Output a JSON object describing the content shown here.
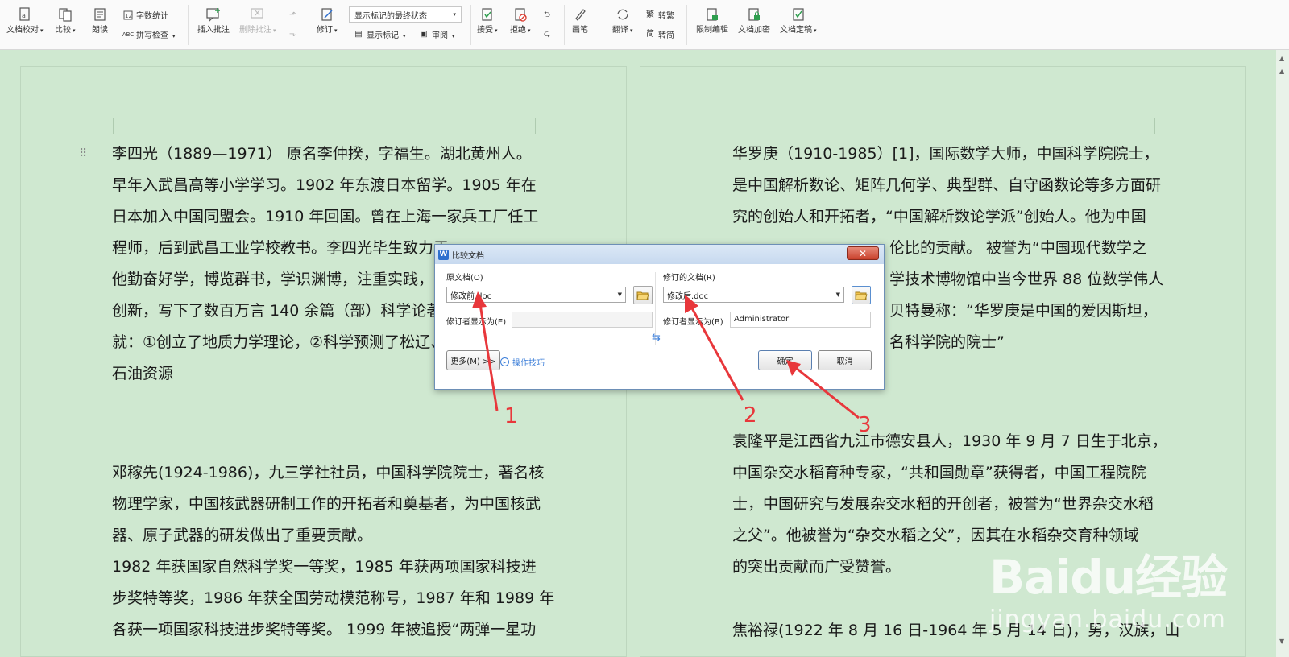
{
  "toolbar": {
    "doc_check": "文档校对",
    "compare": "比较",
    "read_aloud": "朗读",
    "word_count": "字数统计",
    "spell_check": "拼写检查",
    "insert_comment": "插入批注",
    "delete_comment": "删除批注",
    "revise": "修订",
    "markup_state": "显示标记的最终状态",
    "show_markup": "显示标记",
    "review": "审阅",
    "accept": "接受",
    "reject": "拒绝",
    "pen": "画笔",
    "translate": "翻译",
    "to_traditional": "转繁",
    "to_simplified": "转简",
    "restrict_edit": "限制编辑",
    "encrypt": "文档加密",
    "finalize": "文档定稿",
    "abc": "ABC"
  },
  "left_page": {
    "para1": [
      "李四光（1889—1971） 原名李仲揆，字福生。湖北黄州人。",
      "早年入武昌高等小学学习。1902 年东渡日本留学。1905 年在",
      "日本加入中国同盟会。1910 年回国。曾在上海一家兵工厂任工",
      "程师，后到武昌工业学校教书。李四光毕生致力于",
      "他勤奋好学，博览群书，学识渊博，注重实践，",
      "创新，写下了数百万言 140 余篇（部）科学论著",
      "就：①创立了地质力学理论，②科学预测了松辽、",
      "石油资源"
    ],
    "para2": [
      "邓稼先(1924-1986)，九三学社社员，中国科学院院士，著名核",
      "物理学家，中国核武器研制工作的开拓者和奠基者，为中国核武",
      "器、原子武器的研发做出了重要贡献。",
      "1982 年获国家自然科学奖一等奖，1985 年获两项国家科技进",
      "步奖特等奖，1986 年获全国劳动模范称号，1987 年和 1989 年",
      "各获一项国家科技进步奖特等奖。 1999 年被追授“两弹一星功"
    ]
  },
  "right_page": {
    "para1": [
      "华罗庚（1910-1985）[1]，国际数学大师，中国科学院院士，",
      "是中国解析数论、矩阵几何学、典型群、自守函数论等多方面研",
      "究的创始人和开拓者，“中国解析数论学派”创始人。他为中国",
      "伦比的贡献。 被誉为“中国现代数学之",
      "学技术博物馆中当今世界 88 位数学伟人",
      "贝特曼称：“华罗庚是中国的爱因斯坦，",
      "名科学院的院士”"
    ],
    "para2": [
      "袁隆平是江西省九江市德安县人，1930 年 9 月 7 日生于北京，",
      "中国杂交水稻育种专家，“共和国勋章”获得者，中国工程院院",
      "士，中国研究与发展杂交水稻的开创者，被誉为“世界杂交水稻",
      "之父”。他被誉为“杂交水稻之父”，因其在水稻杂交育种领域",
      "的突出贡献而广受赞誉。"
    ],
    "para3": [
      "焦裕禄(1922 年 8 月 16 日-1964 年 5 月 14 日)，男，汉族，山"
    ]
  },
  "dialog": {
    "title": "比较文档",
    "original_label": "原文档(O)",
    "original_value": "修改前.doc",
    "revised_label": "修订的文档(R)",
    "revised_value": "修改后.doc",
    "author_label_left": "修订者显示为(E)",
    "author_label_right": "修订者显示为(B)",
    "author_value": "Administrator",
    "more_button": "更多(M) >>",
    "tips_link": "操作技巧",
    "ok_button": "确定",
    "cancel_button": "取消",
    "close": "✕"
  },
  "annotations": [
    "1",
    "2",
    "3"
  ],
  "watermark": {
    "brand": "Baidu经验",
    "url": "jingyan.baidu.com"
  },
  "colors": {
    "page_bg": "#cfe8d0",
    "annotation_red": "#e8373b",
    "link_blue": "#3d7fd9"
  }
}
